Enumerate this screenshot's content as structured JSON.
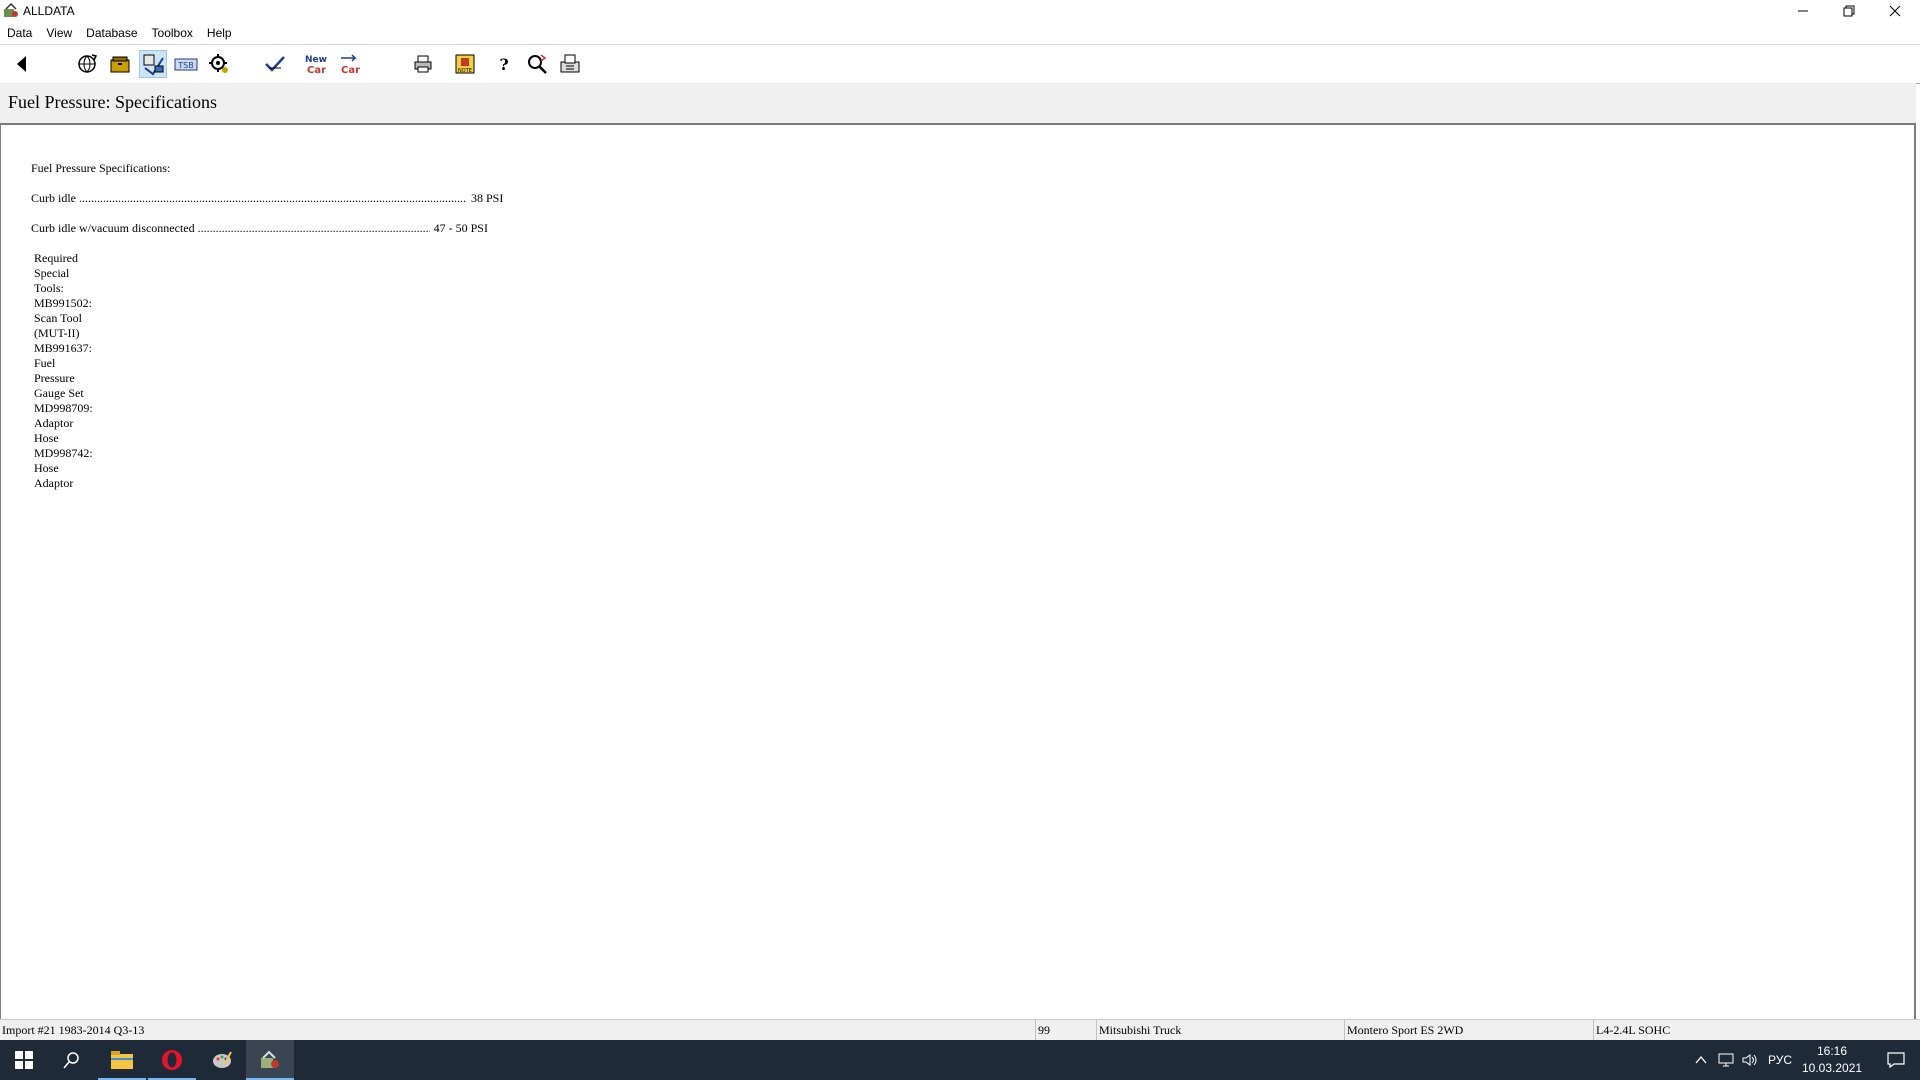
{
  "window": {
    "title": "ALLDATA"
  },
  "menu": [
    "Data",
    "View",
    "Database",
    "Toolbox",
    "Help"
  ],
  "toolbar": {
    "icons": [
      "back-arrow-icon",
      "globe-refresh-icon",
      "folder-icon",
      "vehicle-select-icon",
      "tsb-icon",
      "component-locator-icon",
      "check-icon",
      "new-car-icon",
      "change-car-icon",
      "print-icon",
      "note-icon",
      "help-icon",
      "search-icon",
      "fax-icon"
    ]
  },
  "header": {
    "title": "Fuel Pressure:  Specifications"
  },
  "document": {
    "heading": "Fuel Pressure Specifications:",
    "specs": [
      {
        "label": "Curb idle",
        "value": "38 PSI"
      },
      {
        "label": "Curb idle w/vacuum disconnected",
        "value": "47 - 50 PSI"
      }
    ],
    "tools_heading": "Required Special Tools:",
    "tools": [
      "MB991502: Scan Tool (MUT-II)",
      "MB991637: Fuel Pressure Gauge Set",
      "MD998709: Adaptor Hose",
      "MD998742: Hose Adaptor"
    ]
  },
  "status": {
    "database": "Import #21 1983-2014 Q3-13",
    "year": "99",
    "make": "Mitsubishi Truck",
    "model": "Montero Sport ES  2WD",
    "engine": "L4-2.4L SOHC"
  },
  "taskbar": {
    "language": "РУС",
    "time": "16:16",
    "date": "10.03.2021"
  },
  "colors": {
    "taskbar_bg": "#1f2a38",
    "accent": "#76b9ed",
    "header_bg": "#f0f0f0"
  }
}
